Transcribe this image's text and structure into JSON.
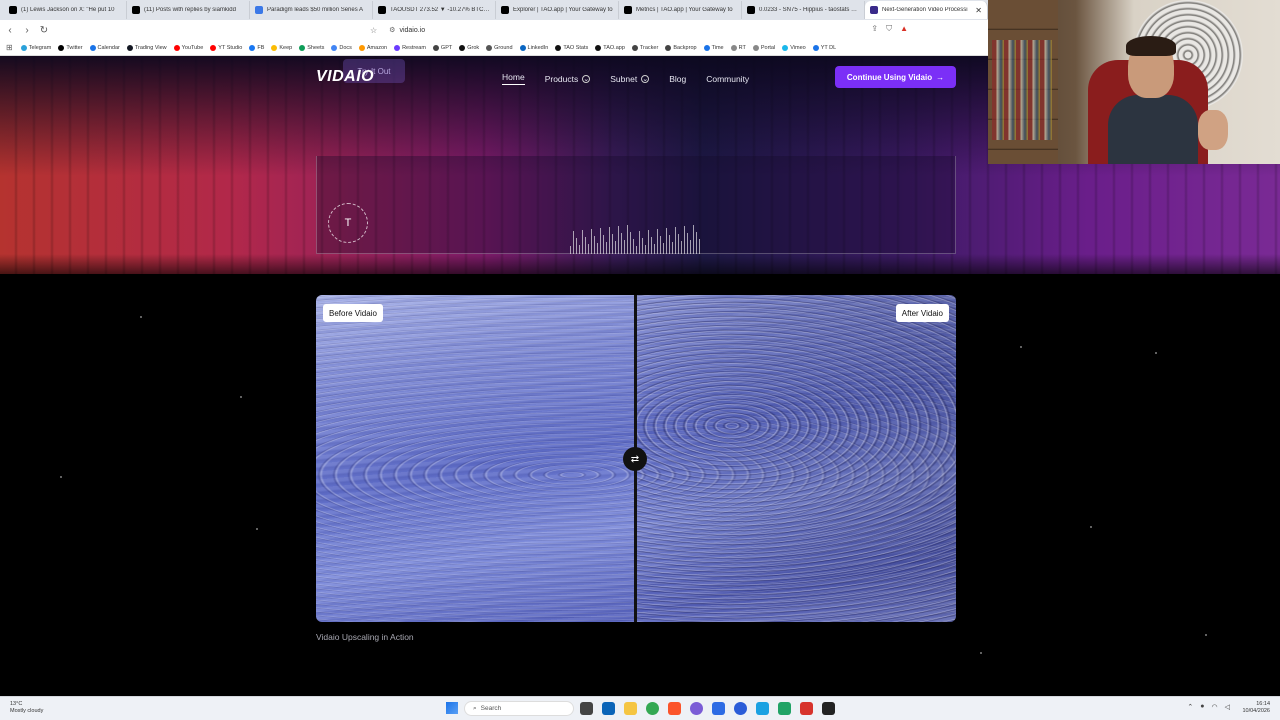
{
  "browser": {
    "tabs": [
      {
        "title": "(1) Lewis Jackson on X: \"He put 10",
        "color": "#000000"
      },
      {
        "title": "(11) Posts with replies by siamkidd",
        "color": "#000000"
      },
      {
        "title": "Paradigm leads $50 million Series A",
        "color": "#3b78e7"
      },
      {
        "title": "TAOUSDT 273.52 ▼ -10.27% BTC Cr",
        "color": "#000000"
      },
      {
        "title": "Explorer | TAO.app | Your Gateway to",
        "color": "#000000"
      },
      {
        "title": "Metrics | TAO.app | Your Gateway to",
        "color": "#000000"
      },
      {
        "title": "0.0233 - SN75 - Hippius - taostats - Cr",
        "color": "#000000"
      },
      {
        "title": "Next-Generation Video Processi",
        "color": "#3a2a8a",
        "active": true
      }
    ],
    "close_glyph": "✕",
    "url": "vidaio.io",
    "bookmarks": [
      {
        "label": "Telegram",
        "color": "#2aa1da"
      },
      {
        "label": "Twitter",
        "color": "#000000"
      },
      {
        "label": "Calendar",
        "color": "#1a73e8"
      },
      {
        "label": "Trading View",
        "color": "#131722"
      },
      {
        "label": "YouTube",
        "color": "#ff0000"
      },
      {
        "label": "YT Studio",
        "color": "#ff0000"
      },
      {
        "label": "FB",
        "color": "#1877f2"
      },
      {
        "label": "Keep",
        "color": "#fbbc04"
      },
      {
        "label": "Sheets",
        "color": "#0f9d58"
      },
      {
        "label": "Docs",
        "color": "#4285f4"
      },
      {
        "label": "Amazon",
        "color": "#ff9900"
      },
      {
        "label": "Restream",
        "color": "#6b3bff"
      },
      {
        "label": "GPT",
        "color": "#444444"
      },
      {
        "label": "Grok",
        "color": "#111111"
      },
      {
        "label": "Ground",
        "color": "#555555"
      },
      {
        "label": "LinkedIn",
        "color": "#0a66c2"
      },
      {
        "label": "TAO Stats",
        "color": "#111111"
      },
      {
        "label": "TAO.app",
        "color": "#111111"
      },
      {
        "label": "Tracker",
        "color": "#444444"
      },
      {
        "label": "Backprop",
        "color": "#444444"
      },
      {
        "label": "Time",
        "color": "#1a73e8"
      },
      {
        "label": "RT",
        "color": "#888888"
      },
      {
        "label": "Portal",
        "color": "#888888"
      },
      {
        "label": "Vimeo",
        "color": "#1ab7ea"
      },
      {
        "label": "YT DL",
        "color": "#1a73e8"
      }
    ]
  },
  "site": {
    "logo": "VIDAIO",
    "try_it_out": "Try It Out",
    "nav": [
      {
        "label": "Home",
        "active": true
      },
      {
        "label": "Products",
        "dropdown": true
      },
      {
        "label": "Subnet",
        "dropdown": true
      },
      {
        "label": "Blog"
      },
      {
        "label": "Community"
      }
    ],
    "cta": "Continue Using Vidaio",
    "cta_arrow": "→",
    "badge_letter": "T",
    "compare": {
      "before_label": "Before Vidaio",
      "after_label": "After Vidaio",
      "handle_glyph": "⇄"
    },
    "caption": "Vidaio Upscaling in Action"
  },
  "taskbar": {
    "weather_temp": "13°C",
    "weather_desc": "Mostly cloudy",
    "search_placeholder": "Search",
    "time": "16:14",
    "date": "10/04/2026"
  },
  "colors": {
    "accent": "#7b2ff7",
    "page_bg": "#000000"
  }
}
